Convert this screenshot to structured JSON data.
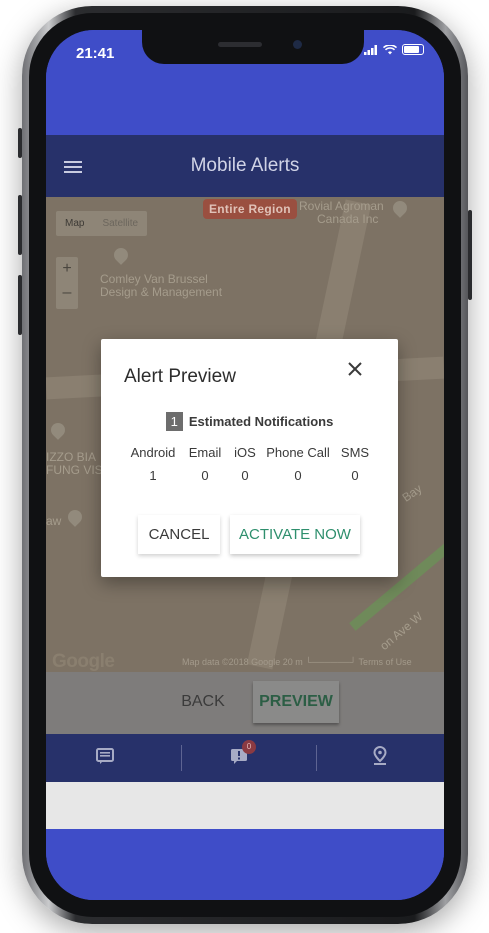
{
  "status_bar": {
    "time": "21:41",
    "signal_icon": "signal-icon",
    "wifi_icon": "wifi-icon",
    "battery_icon": "battery-icon"
  },
  "app_bar": {
    "title": "Mobile Alerts",
    "menu_icon": "hamburger-menu-icon"
  },
  "map": {
    "type_options": [
      "Map",
      "Satellite"
    ],
    "zoom_in": "+",
    "zoom_out": "–",
    "region_badge": "Entire Region",
    "labels": {
      "place1_line1": "Rovial Agroman",
      "place1_line2": "Canada Inc",
      "place2_line1": "Comley Van Brussel",
      "place2_line2": "Design & Management",
      "place3_line1": "IZZO BIA",
      "place3_line2": "FUNG VIS",
      "place4": "aw",
      "street1": "Bay",
      "street2": "on Ave W"
    },
    "google_logo": "Google",
    "footer": "Map data ©2018 Google   20 m └──────┘   Terms of Use"
  },
  "dialog": {
    "title": "Alert Preview",
    "close_icon": "close-icon",
    "estimated_count": "1",
    "estimated_label": "Estimated Notifications",
    "channels": [
      {
        "name": "Android",
        "count": "1"
      },
      {
        "name": "Email",
        "count": "0"
      },
      {
        "name": "iOS",
        "count": "0"
      },
      {
        "name": "Phone Call",
        "count": "0"
      },
      {
        "name": "SMS",
        "count": "0"
      }
    ],
    "cancel_label": "CANCEL",
    "activate_label": "ACTIVATE NOW"
  },
  "actions": {
    "back_label": "BACK",
    "preview_label": "PREVIEW"
  },
  "tab_bar": {
    "tabs": [
      {
        "icon": "list-icon"
      },
      {
        "icon": "alert-icon",
        "badge": "0"
      },
      {
        "icon": "location-pin-icon"
      }
    ]
  },
  "colors": {
    "primary": "#3f4dc8",
    "app_bar": "#27316a",
    "accent_green": "#2e8f6d",
    "badge_red": "#9a4f40"
  }
}
